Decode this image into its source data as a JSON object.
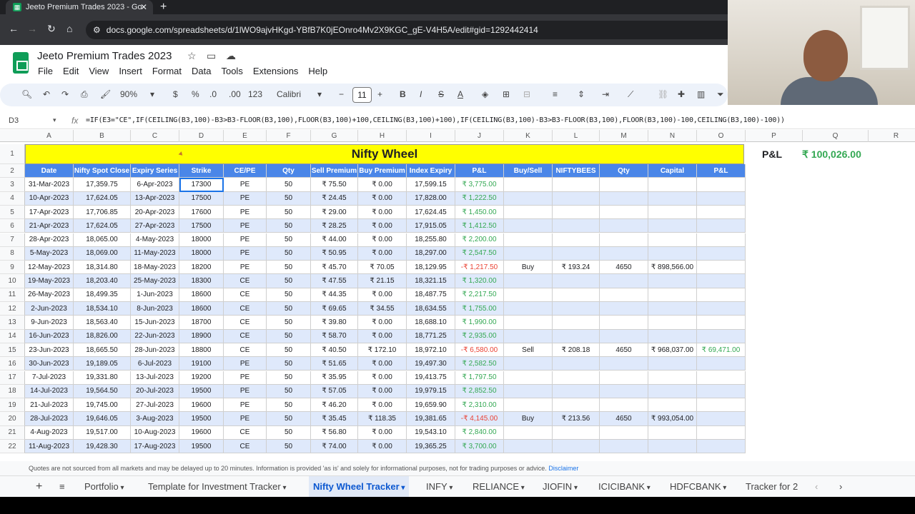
{
  "browser": {
    "tab_title": "Jeeto Premium Trades 2023 - Go",
    "url": "docs.google.com/spreadsheets/d/1lWO9ajvHKgd-YBfB7K0jEOnro4Mv2X9KGC_gE-V4H5A/edit#gid=1292442414"
  },
  "doc": {
    "title": "Jeeto Premium Trades 2023",
    "menus": [
      "File",
      "Edit",
      "View",
      "Insert",
      "Format",
      "Data",
      "Tools",
      "Extensions",
      "Help"
    ]
  },
  "toolbar": {
    "zoom": "90%",
    "currency": "$",
    "percent": "%",
    "dec_less": ".0",
    "dec_more": ".00",
    "num_format": "123",
    "font": "Calibri",
    "font_size": "11",
    "bold": "B",
    "italic": "I",
    "strike": "S",
    "text_color": "A"
  },
  "formula_bar": {
    "cell_ref": "D3",
    "fx": "fx",
    "formula": "=IF(E3=\"CE\",IF(CEILING(B3,100)-B3>B3-FLOOR(B3,100),FLOOR(B3,100)+100,CEILING(B3,100)+100),IF(CEILING(B3,100)-B3>B3-FLOOR(B3,100),FLOOR(B3,100)-100,CEILING(B3,100)-100))"
  },
  "columns": [
    "A",
    "B",
    "C",
    "D",
    "E",
    "F",
    "G",
    "H",
    "I",
    "J",
    "K",
    "L",
    "M",
    "N",
    "O",
    "P",
    "Q",
    "R"
  ],
  "sheet": {
    "title": "Nifty Wheel",
    "pl_label": "P&L",
    "pl_value": "₹ 100,026.00",
    "headers": [
      "Date",
      "Nifty Spot Close",
      "Expiry Series",
      "Strike",
      "CE/PE",
      "Qty",
      "Sell Premium",
      "Buy Premium",
      "Index Expiry",
      "P&L",
      "Buy/Sell",
      "NIFTYBEES",
      "Qty",
      "Capital",
      "P&L"
    ],
    "rows": [
      [
        "31-Mar-2023",
        "17,359.75",
        "6-Apr-2023",
        "17300",
        "PE",
        "50",
        "₹ 75.50",
        "₹ 0.00",
        "17,599.15",
        "₹ 3,775.00",
        "",
        "",
        "",
        "",
        ""
      ],
      [
        "10-Apr-2023",
        "17,624.05",
        "13-Apr-2023",
        "17500",
        "PE",
        "50",
        "₹ 24.45",
        "₹ 0.00",
        "17,828.00",
        "₹ 1,222.50",
        "",
        "",
        "",
        "",
        ""
      ],
      [
        "17-Apr-2023",
        "17,706.85",
        "20-Apr-2023",
        "17600",
        "PE",
        "50",
        "₹ 29.00",
        "₹ 0.00",
        "17,624.45",
        "₹ 1,450.00",
        "",
        "",
        "",
        "",
        ""
      ],
      [
        "21-Apr-2023",
        "17,624.05",
        "27-Apr-2023",
        "17500",
        "PE",
        "50",
        "₹ 28.25",
        "₹ 0.00",
        "17,915.05",
        "₹ 1,412.50",
        "",
        "",
        "",
        "",
        ""
      ],
      [
        "28-Apr-2023",
        "18,065.00",
        "4-May-2023",
        "18000",
        "PE",
        "50",
        "₹ 44.00",
        "₹ 0.00",
        "18,255.80",
        "₹ 2,200.00",
        "",
        "",
        "",
        "",
        ""
      ],
      [
        "5-May-2023",
        "18,069.00",
        "11-May-2023",
        "18000",
        "PE",
        "50",
        "₹ 50.95",
        "₹ 0.00",
        "18,297.00",
        "₹ 2,547.50",
        "",
        "",
        "",
        "",
        ""
      ],
      [
        "12-May-2023",
        "18,314.80",
        "18-May-2023",
        "18200",
        "PE",
        "50",
        "₹ 45.70",
        "₹ 70.05",
        "18,129.95",
        "-₹ 1,217.50",
        "Buy",
        "₹ 193.24",
        "4650",
        "₹ 898,566.00",
        ""
      ],
      [
        "19-May-2023",
        "18,203.40",
        "25-May-2023",
        "18300",
        "CE",
        "50",
        "₹ 47.55",
        "₹ 21.15",
        "18,321.15",
        "₹ 1,320.00",
        "",
        "",
        "",
        "",
        ""
      ],
      [
        "26-May-2023",
        "18,499.35",
        "1-Jun-2023",
        "18600",
        "CE",
        "50",
        "₹ 44.35",
        "₹ 0.00",
        "18,487.75",
        "₹ 2,217.50",
        "",
        "",
        "",
        "",
        ""
      ],
      [
        "2-Jun-2023",
        "18,534.10",
        "8-Jun-2023",
        "18600",
        "CE",
        "50",
        "₹ 69.65",
        "₹ 34.55",
        "18,634.55",
        "₹ 1,755.00",
        "",
        "",
        "",
        "",
        ""
      ],
      [
        "9-Jun-2023",
        "18,563.40",
        "15-Jun-2023",
        "18700",
        "CE",
        "50",
        "₹ 39.80",
        "₹ 0.00",
        "18,688.10",
        "₹ 1,990.00",
        "",
        "",
        "",
        "",
        ""
      ],
      [
        "16-Jun-2023",
        "18,826.00",
        "22-Jun-2023",
        "18900",
        "CE",
        "50",
        "₹ 58.70",
        "₹ 0.00",
        "18,771.25",
        "₹ 2,935.00",
        "",
        "",
        "",
        "",
        ""
      ],
      [
        "23-Jun-2023",
        "18,665.50",
        "28-Jun-2023",
        "18800",
        "CE",
        "50",
        "₹ 40.50",
        "₹ 172.10",
        "18,972.10",
        "-₹ 6,580.00",
        "Sell",
        "₹ 208.18",
        "4650",
        "₹ 968,037.00",
        "₹ 69,471.00"
      ],
      [
        "30-Jun-2023",
        "19,189.05",
        "6-Jul-2023",
        "19100",
        "PE",
        "50",
        "₹ 51.65",
        "₹ 0.00",
        "19,497.30",
        "₹ 2,582.50",
        "",
        "",
        "",
        "",
        ""
      ],
      [
        "7-Jul-2023",
        "19,331.80",
        "13-Jul-2023",
        "19200",
        "PE",
        "50",
        "₹ 35.95",
        "₹ 0.00",
        "19,413.75",
        "₹ 1,797.50",
        "",
        "",
        "",
        "",
        ""
      ],
      [
        "14-Jul-2023",
        "19,564.50",
        "20-Jul-2023",
        "19500",
        "PE",
        "50",
        "₹ 57.05",
        "₹ 0.00",
        "19,979.15",
        "₹ 2,852.50",
        "",
        "",
        "",
        "",
        ""
      ],
      [
        "21-Jul-2023",
        "19,745.00",
        "27-Jul-2023",
        "19600",
        "PE",
        "50",
        "₹ 46.20",
        "₹ 0.00",
        "19,659.90",
        "₹ 2,310.00",
        "",
        "",
        "",
        "",
        ""
      ],
      [
        "28-Jul-2023",
        "19,646.05",
        "3-Aug-2023",
        "19500",
        "PE",
        "50",
        "₹ 35.45",
        "₹ 118.35",
        "19,381.65",
        "-₹ 4,145.00",
        "Buy",
        "₹ 213.56",
        "4650",
        "₹ 993,054.00",
        ""
      ],
      [
        "4-Aug-2023",
        "19,517.00",
        "10-Aug-2023",
        "19600",
        "CE",
        "50",
        "₹ 56.80",
        "₹ 0.00",
        "19,543.10",
        "₹ 2,840.00",
        "",
        "",
        "",
        "",
        ""
      ],
      [
        "11-Aug-2023",
        "19,428.30",
        "17-Aug-2023",
        "19500",
        "CE",
        "50",
        "₹ 74.00",
        "₹ 0.00",
        "19,365.25",
        "₹ 3,700.00",
        "",
        "",
        "",
        "",
        ""
      ]
    ]
  },
  "footer_note": {
    "text": "Quotes are not sourced from all markets and may be delayed up to 20 minutes. Information is provided 'as is' and solely for informational purposes, not for trading purposes or advice.",
    "link": "Disclaimer"
  },
  "sheet_tabs": [
    "Portfolio",
    "Template for Investment Tracker",
    "Nifty Wheel Tracker",
    "INFY",
    "RELIANCE",
    "JIOFIN",
    "ICICIBANK",
    "HDFCBANK",
    "Tracker for 2"
  ],
  "active_sheet_tab": "Nifty Wheel Tracker",
  "colors": {
    "header_blue": "#4a86e8",
    "title_yellow": "#ffff00",
    "stripe": "#dfe9fb",
    "profit": "#34a853",
    "loss": "#ea4335"
  }
}
